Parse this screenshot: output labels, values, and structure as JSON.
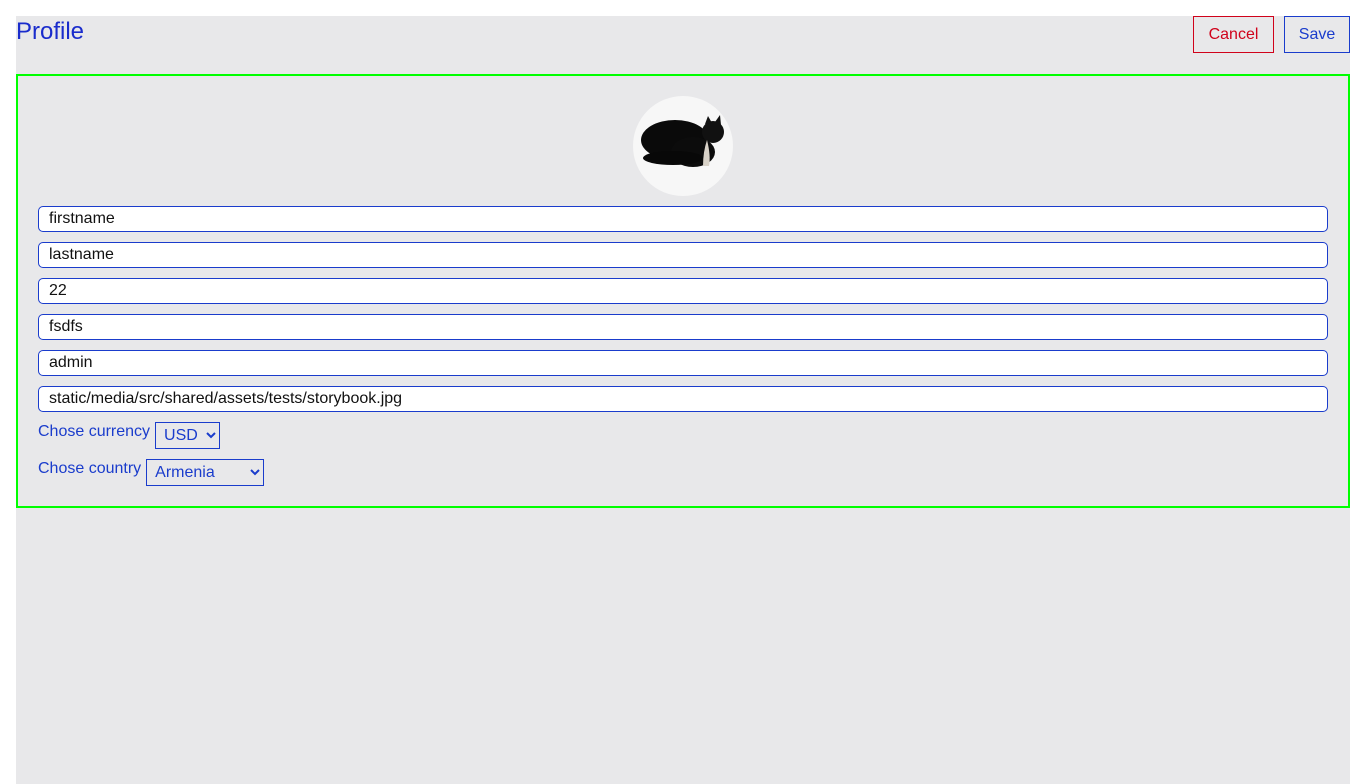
{
  "header": {
    "title": "Profile",
    "cancel_label": "Cancel",
    "save_label": "Save"
  },
  "colors": {
    "accent": "#1a3ccc",
    "cancel": "#d0021b",
    "card_border": "#00ff00",
    "background": "#e8e8ea"
  },
  "avatar": {
    "icon": "cat-photo"
  },
  "fields": [
    "firstname",
    "lastname",
    "22",
    "fsdfs",
    "admin",
    "static/media/src/shared/assets/tests/storybook.jpg"
  ],
  "currency": {
    "label": "Chose currency",
    "selected": "USD"
  },
  "country": {
    "label": "Chose country",
    "selected": "Armenia"
  }
}
